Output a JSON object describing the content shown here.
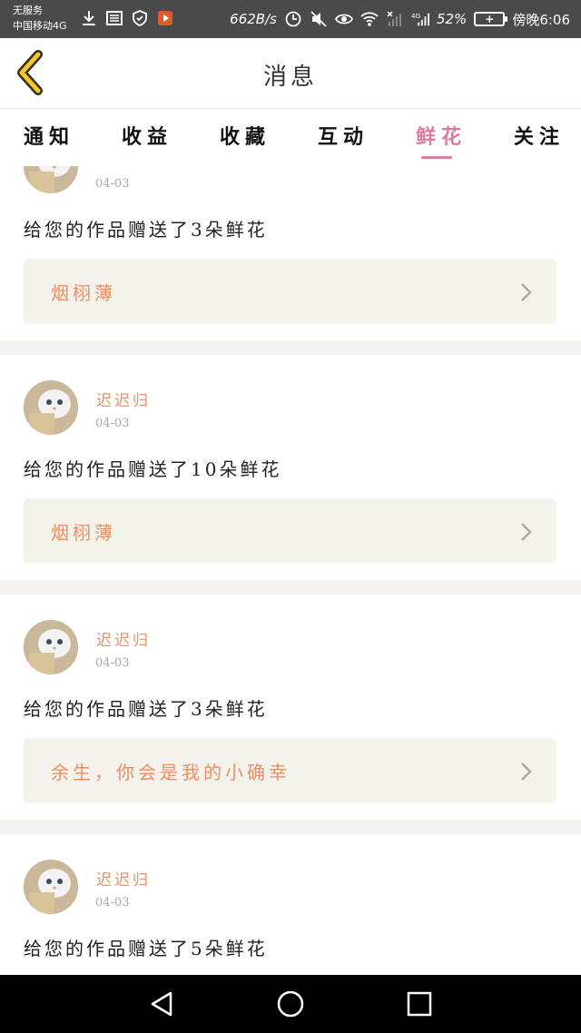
{
  "status_bar": {
    "carrier_line1": "无服务",
    "carrier_line2": "中国移动4G",
    "speed": "662B/s",
    "network": "4G",
    "battery": "52%",
    "time": "傍晚6:06"
  },
  "header": {
    "title": "消息"
  },
  "tabs": [
    {
      "label": "通知"
    },
    {
      "label": "收益"
    },
    {
      "label": "收藏"
    },
    {
      "label": "互动"
    },
    {
      "label": "鲜花",
      "active": true
    },
    {
      "label": "关注"
    }
  ],
  "feed": [
    {
      "username": "",
      "date": "04-03",
      "message": "给您的作品赠送了3朵鲜花",
      "work": "烟栩薄"
    },
    {
      "username": "迟迟归",
      "date": "04-03",
      "message": "给您的作品赠送了10朵鲜花",
      "work": "烟栩薄"
    },
    {
      "username": "迟迟归",
      "date": "04-03",
      "message": "给您的作品赠送了3朵鲜花",
      "work": "余生，你会是我的小确幸"
    },
    {
      "username": "迟迟归",
      "date": "04-03",
      "message": "给您的作品赠送了5朵鲜花",
      "work": ""
    }
  ],
  "colors": {
    "accent_pink": "#e07aa0",
    "username_orange": "#e8926a",
    "link_orange": "#ef8e63",
    "back_arrow_yellow": "#f2c830"
  }
}
